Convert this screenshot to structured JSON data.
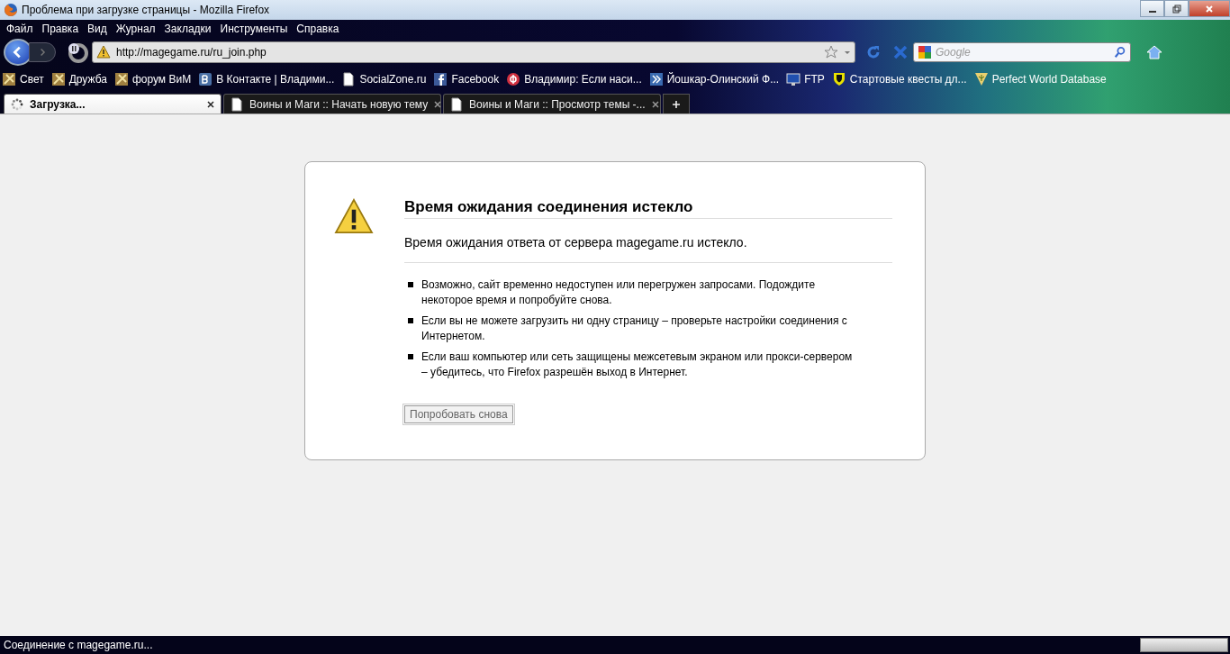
{
  "window": {
    "title": "Проблема при загрузке страницы - Mozilla Firefox"
  },
  "menu": [
    "Файл",
    "Правка",
    "Вид",
    "Журнал",
    "Закладки",
    "Инструменты",
    "Справка"
  ],
  "address": {
    "value": "http://magegame.ru/ru_join.php"
  },
  "search": {
    "placeholder": "Google"
  },
  "bookmarks": [
    {
      "label": "Свет",
      "kind": "game"
    },
    {
      "label": "Дружба",
      "kind": "game"
    },
    {
      "label": "форум ВиМ",
      "kind": "game"
    },
    {
      "label": "В Контакте | Владими...",
      "kind": "vk"
    },
    {
      "label": "SocialZone.ru",
      "kind": "page"
    },
    {
      "label": "Facebook",
      "kind": "facebook"
    },
    {
      "label": "Владимир: Если наси...",
      "kind": "round"
    },
    {
      "label": "Йошкар-Олинский Ф...",
      "kind": "arrows"
    },
    {
      "label": "FTP",
      "kind": "monitor"
    },
    {
      "label": "Стартовые квесты дл...",
      "kind": "shield"
    },
    {
      "label": "Perfect World Database",
      "kind": "badge"
    }
  ],
  "tabs": [
    {
      "label": "Загрузка...",
      "selected": true,
      "loading": true
    },
    {
      "label": "Воины и Маги :: Начать новую тему",
      "selected": false,
      "loading": false
    },
    {
      "label": "Воины и Маги :: Просмотр темы -...",
      "selected": false,
      "loading": false
    }
  ],
  "error": {
    "title": "Время ожидания соединения истекло",
    "message": "Время ожидания ответа от сервера magegame.ru истекло.",
    "items": [
      "Возможно, сайт временно недоступен или перегружен запросами. Подождите некоторое время и попробуйте снова.",
      "Если вы не можете загрузить ни одну страницу – проверьте настройки соединения с Интернетом.",
      "Если ваш компьютер или сеть защищены межсетевым экраном или прокси-сервером – убедитесь, что Firefox разрешён выход в Интернет."
    ],
    "button": "Попробовать снова"
  },
  "status_bar": {
    "text": "Соединение с magegame.ru...",
    "level": 0
  }
}
